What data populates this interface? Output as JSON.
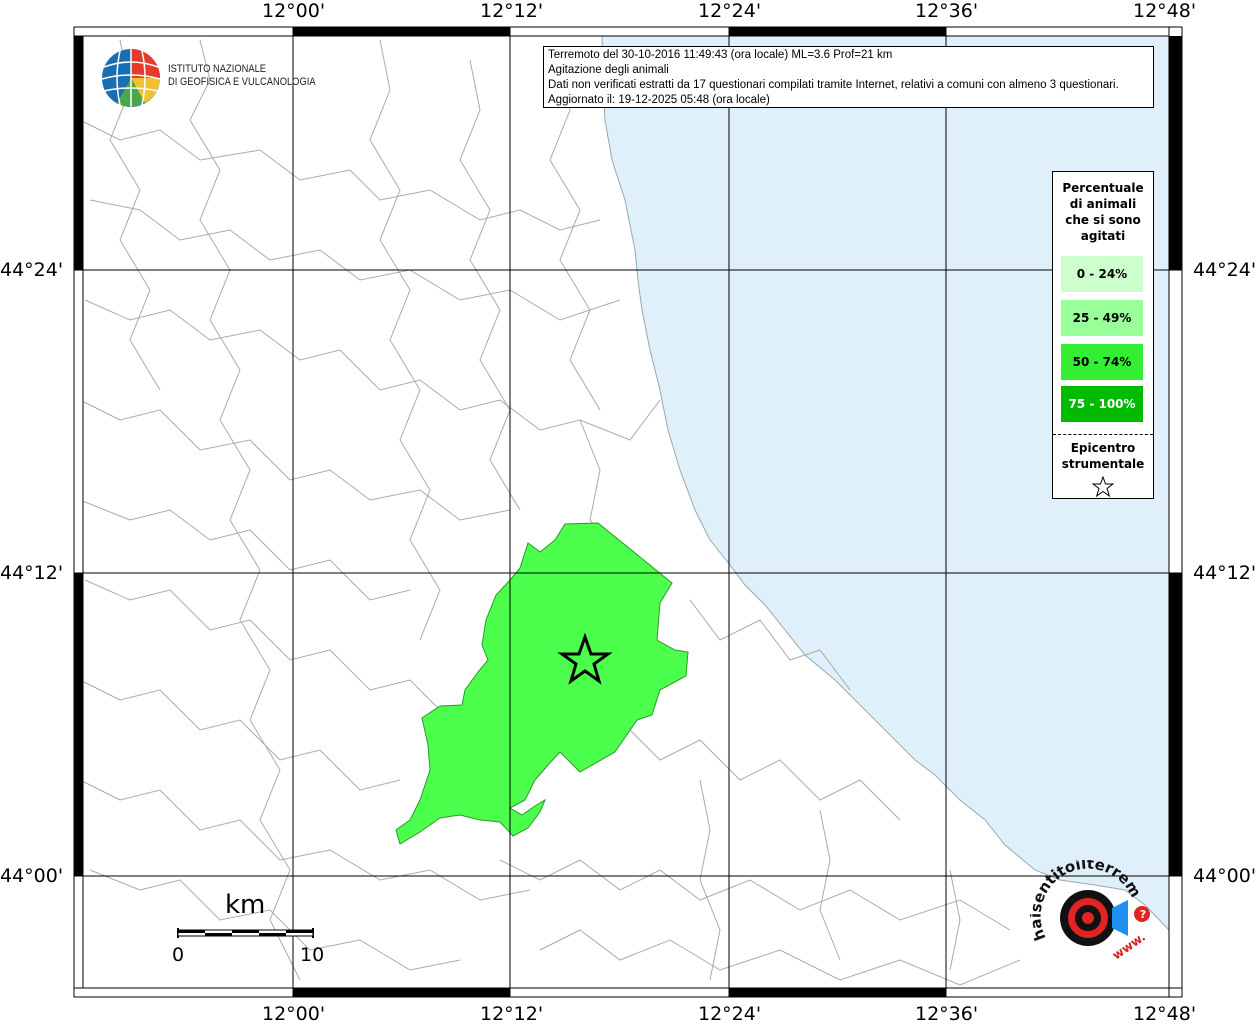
{
  "info": {
    "line1": "Terremoto del 30-10-2016 11:49:43 (ora locale) ML=3.6 Prof=21 km",
    "line2": "Agitazione degli animali",
    "line3": "Dati non verificati estratti da 17 questionari compilati tramite Internet, relativi a comuni con almeno 3 questionari.",
    "line4": "Aggiornato il: 19-12-2025 05:48 (ora locale)"
  },
  "logo": {
    "line1": "ISTITUTO NAZIONALE",
    "line2": "DI GEOFISICA E VULCANOLOGIA"
  },
  "axes": {
    "lon_ticks": [
      "12°00'",
      "12°12'",
      "12°24'",
      "12°36'",
      "12°48'"
    ],
    "lat_ticks": [
      "44°24'",
      "44°12'",
      "44°00'"
    ]
  },
  "legend": {
    "title_lines": [
      "Percentuale",
      "di animali",
      "che si sono",
      "agitati"
    ],
    "classes": [
      {
        "label": "0 - 24%",
        "color": "#ccffcc",
        "text_color": "#000000"
      },
      {
        "label": "25 - 49%",
        "color": "#99ff99",
        "text_color": "#000000"
      },
      {
        "label": "50 - 74%",
        "color": "#33ee33",
        "text_color": "#000000"
      },
      {
        "label": "75 - 100%",
        "color": "#00bb00",
        "text_color": "#ffffff"
      }
    ],
    "epicenter_lines": [
      "Epicentro",
      "strumentale"
    ]
  },
  "scalebar": {
    "unit": "km",
    "min": "0",
    "max": "10"
  },
  "colors": {
    "sea": "#dff0fb",
    "affected_area": "#4cff4c",
    "grid": "#000000",
    "borders": "#aaaaaa"
  },
  "affected_area_class": "50 - 74%",
  "watermark": {
    "text": "haisentitoilterremoto.it",
    "url": "www."
  }
}
